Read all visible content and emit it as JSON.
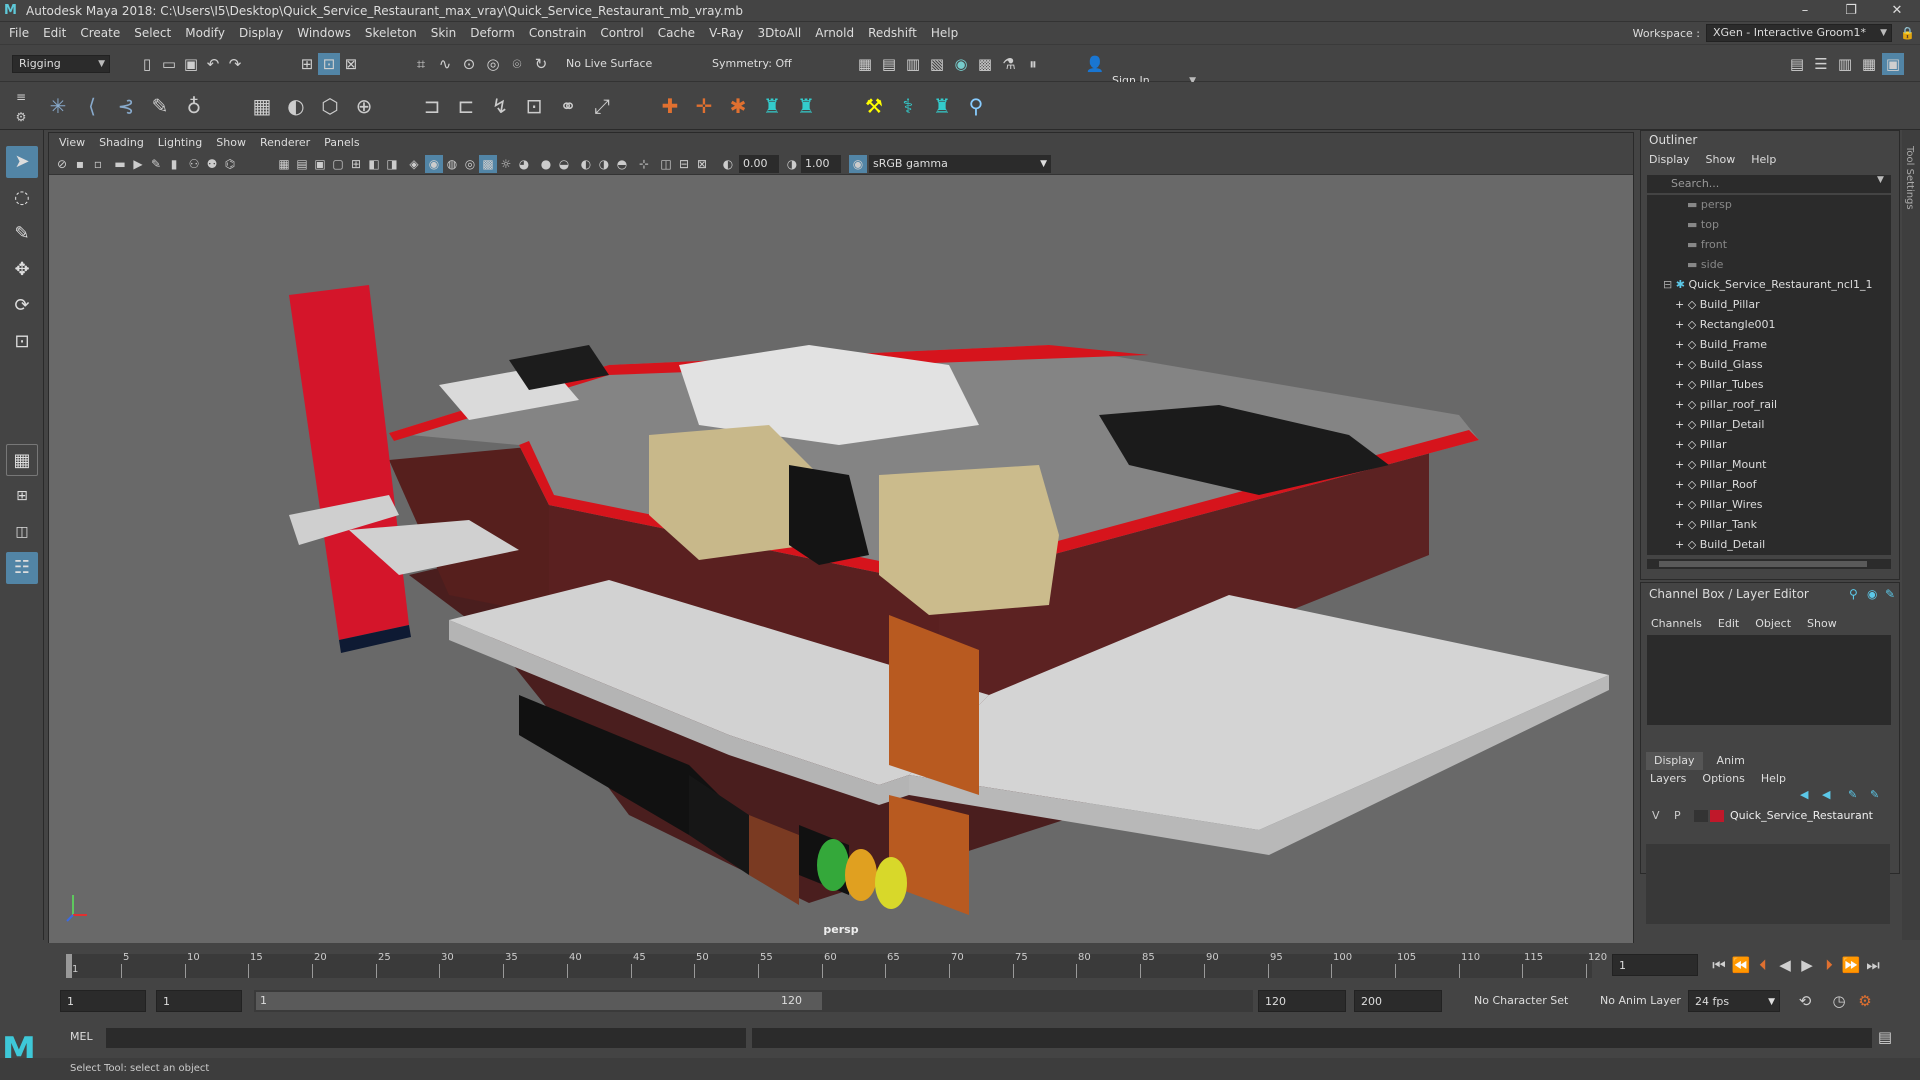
{
  "app": {
    "title": "Autodesk Maya 2018: C:\\Users\\I5\\Desktop\\Quick_Service_Restaurant_max_vray\\Quick_Service_Restaurant_mb_vray.mb"
  },
  "menu": [
    "File",
    "Edit",
    "Create",
    "Select",
    "Modify",
    "Display",
    "Windows",
    "Skeleton",
    "Skin",
    "Deform",
    "Constrain",
    "Control",
    "Cache",
    "V-Ray",
    "3DtoAll",
    "Arnold",
    "Redshift",
    "Help"
  ],
  "workspace": {
    "label": "Workspace :",
    "value": "XGen - Interactive Groom1*"
  },
  "status": {
    "menuset": "Rigging",
    "live_surface": "No Live Surface",
    "symmetry": "Symmetry: Off",
    "sign_in": "Sign In"
  },
  "viewport": {
    "menu": [
      "View",
      "Shading",
      "Lighting",
      "Show",
      "Renderer",
      "Panels"
    ],
    "exposure": "0.00",
    "gamma": "1.00",
    "colorspace": "sRGB gamma",
    "camera": "persp"
  },
  "outliner": {
    "title": "Outliner",
    "menu": [
      "Display",
      "Show",
      "Help"
    ],
    "search_placeholder": "Search...",
    "cameras": [
      "persp",
      "top",
      "front",
      "side"
    ],
    "group": "Quick_Service_Restaurant_ncl1_1",
    "children": [
      "Build_Pillar",
      "Rectangle001",
      "Build_Frame",
      "Build_Glass",
      "Pillar_Tubes",
      "pillar_roof_rail",
      "Pillar_Detail",
      "Pillar",
      "Pillar_Mount",
      "Pillar_Roof",
      "Pillar_Wires",
      "Pillar_Tank",
      "Build_Detail"
    ]
  },
  "channelbox": {
    "title": "Channel Box / Layer Editor",
    "menu": [
      "Channels",
      "Edit",
      "Object",
      "Show"
    ]
  },
  "layers": {
    "tabs": [
      "Display",
      "Anim"
    ],
    "menu": [
      "Layers",
      "Options",
      "Help"
    ],
    "row": {
      "v": "V",
      "p": "P",
      "name": "Quick_Service_Restaurant",
      "color": "#c0182a"
    }
  },
  "timeline": {
    "ticks": [
      "1",
      "5",
      "10",
      "15",
      "20",
      "25",
      "30",
      "35",
      "40",
      "45",
      "50",
      "55",
      "60",
      "65",
      "70",
      "75",
      "80",
      "85",
      "90",
      "95",
      "100",
      "105",
      "110",
      "115",
      "120"
    ],
    "current": "1"
  },
  "range": {
    "start": "1",
    "anim_start": "1",
    "slider_start": "1",
    "slider_end": "120",
    "end": "120",
    "anim_end": "200",
    "char_set": "No Character Set",
    "anim_layer": "No Anim Layer",
    "fps": "24 fps"
  },
  "command": {
    "lang": "MEL"
  },
  "help_line": "Select Tool: select an object",
  "side_tab": "Tool Settings"
}
